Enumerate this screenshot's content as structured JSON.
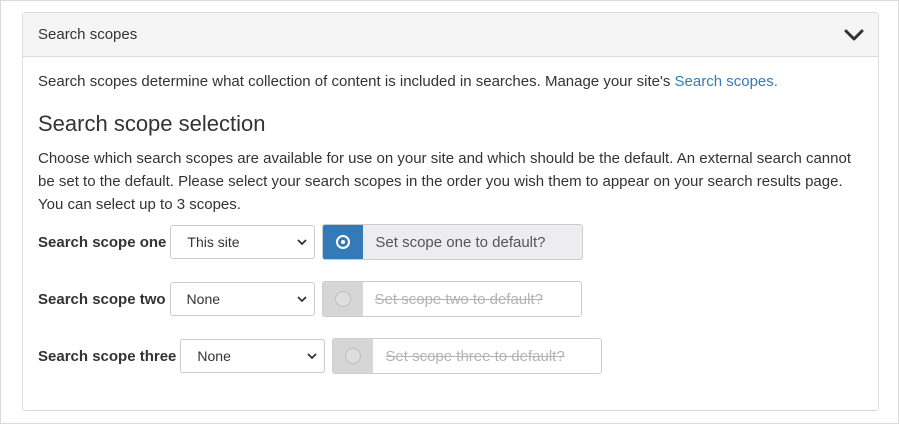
{
  "panel": {
    "title": "Search scopes",
    "intro_text": "Search scopes determine what collection of content is included in searches. Manage your site's ",
    "intro_link": "Search scopes.",
    "section_title": "Search scope selection",
    "description": "Choose which search scopes are available for use on your site and which should be the default. An external search cannot be set to the default. Please select your search scopes in the order you wish them to appear on your search results page. You can select up to 3 scopes."
  },
  "scopes": [
    {
      "label": "Search scope one",
      "selected": "This site",
      "default_label": "Set scope one to default?",
      "default_checked": true,
      "enabled": true
    },
    {
      "label": "Search scope two",
      "selected": "None",
      "default_label": "Set scope two to default?",
      "default_checked": false,
      "enabled": false
    },
    {
      "label": "Search scope three",
      "selected": "None",
      "default_label": "Set scope three to default?",
      "default_checked": false,
      "enabled": false
    }
  ],
  "icons": {
    "collapse": "chevron-down-icon",
    "select_caret": "caret-down-icon",
    "radio": "radio-icon"
  },
  "colors": {
    "accent": "#337ab7",
    "disabled_bg": "#d6d6d6",
    "header_bg": "#f5f5f5"
  }
}
